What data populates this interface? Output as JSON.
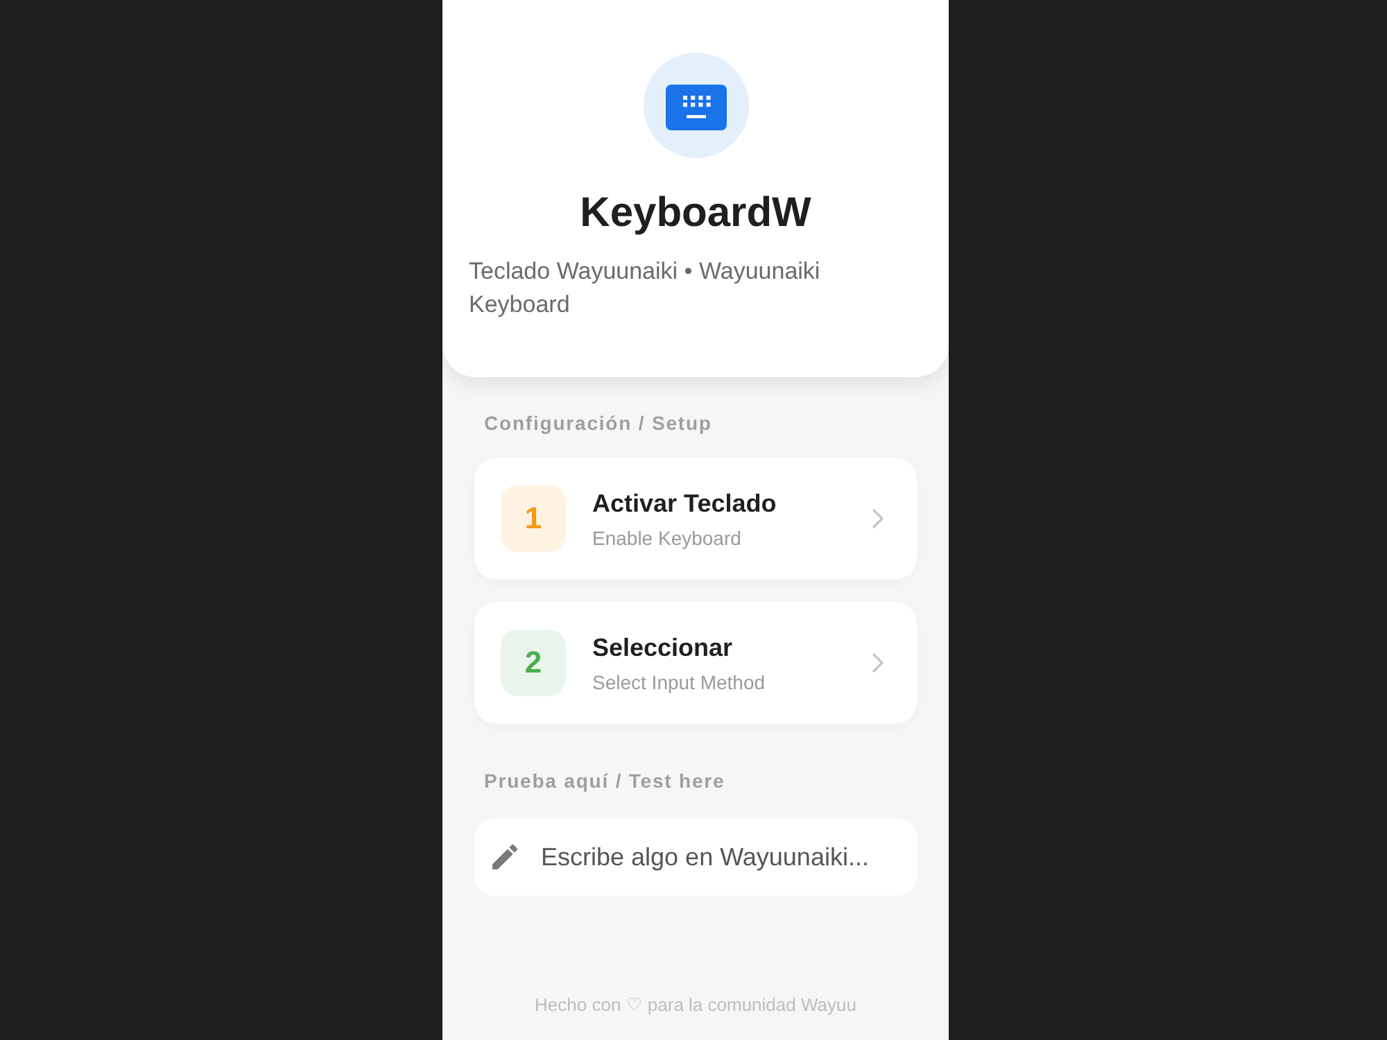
{
  "header": {
    "title": "KeyboardW",
    "subtitle": "Teclado Wayuunaiki • Wayuunaiki Keyboard"
  },
  "setup": {
    "heading": "Configuración / Setup",
    "steps": [
      {
        "number": "1",
        "title": "Activar Teclado",
        "subtitle": "Enable Keyboard",
        "color": "#f39c12"
      },
      {
        "number": "2",
        "title": "Seleccionar",
        "subtitle": "Select Input Method",
        "color": "#4caf50"
      }
    ]
  },
  "test": {
    "heading": "Prueba aquí / Test here",
    "input": {
      "placeholder": "Escribe algo en Wayuunaiki..."
    }
  },
  "footer": "Hecho con ♡ para la comunidad Wayuu"
}
